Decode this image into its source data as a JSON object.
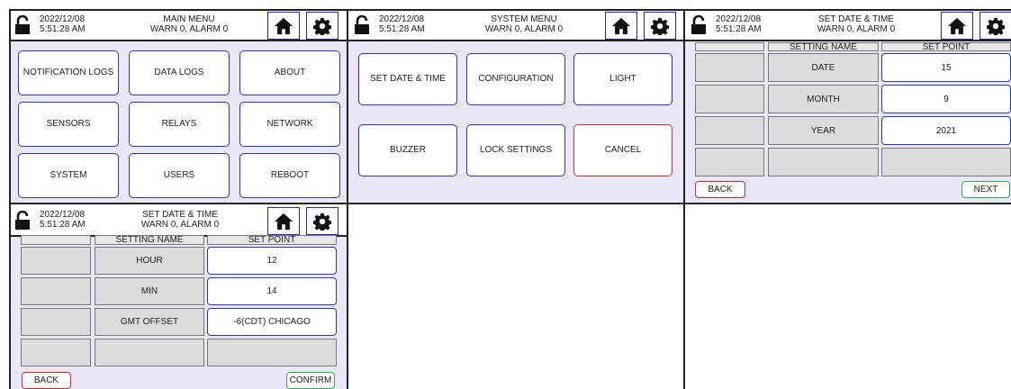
{
  "status": {
    "date": "2022/12/08",
    "time": "5:51:28 AM",
    "warnings": "WARN 0, ALARM 0"
  },
  "icons": {
    "lock": "lock-open-icon",
    "home": "home-icon",
    "settings": "gear-icon"
  },
  "colors": {
    "panel_bg": "#e9e8f8",
    "button_border": "#2a35c9",
    "cancel_border": "#d42a2a",
    "next_border": "#2faa4a"
  },
  "screens": {
    "main_menu": {
      "title": "MAIN MENU",
      "buttons": [
        "NOTIFICATION LOGS",
        "DATA LOGS",
        "ABOUT",
        "SENSORS",
        "RELAYS",
        "NETWORK",
        "SYSTEM",
        "USERS",
        "REBOOT"
      ]
    },
    "system_menu": {
      "title": "SYSTEM MENU",
      "buttons": [
        "SET DATE & TIME",
        "CONFIGURATION",
        "LIGHT",
        "BUZZER",
        "LOCK SETTINGS",
        "CANCEL"
      ]
    },
    "date_setting": {
      "title": "SET DATE & TIME",
      "col_name": "SETTING NAME",
      "col_value": "SET POINT",
      "rows": [
        {
          "name": "DATE",
          "value": "15"
        },
        {
          "name": "MONTH",
          "value": "9"
        },
        {
          "name": "YEAR",
          "value": "2021"
        }
      ],
      "back": "BACK",
      "next": "NEXT"
    },
    "time_setting": {
      "title": "SET DATE & TIME",
      "col_name": "SETTING NAME",
      "col_value": "SET POINT",
      "rows": [
        {
          "name": "HOUR",
          "value": "12"
        },
        {
          "name": "MIN",
          "value": "14"
        },
        {
          "name": "GMT OFFSET",
          "value": "-6(CDT) CHICAGO"
        }
      ],
      "back": "BACK",
      "confirm": "CONFIRM"
    }
  }
}
